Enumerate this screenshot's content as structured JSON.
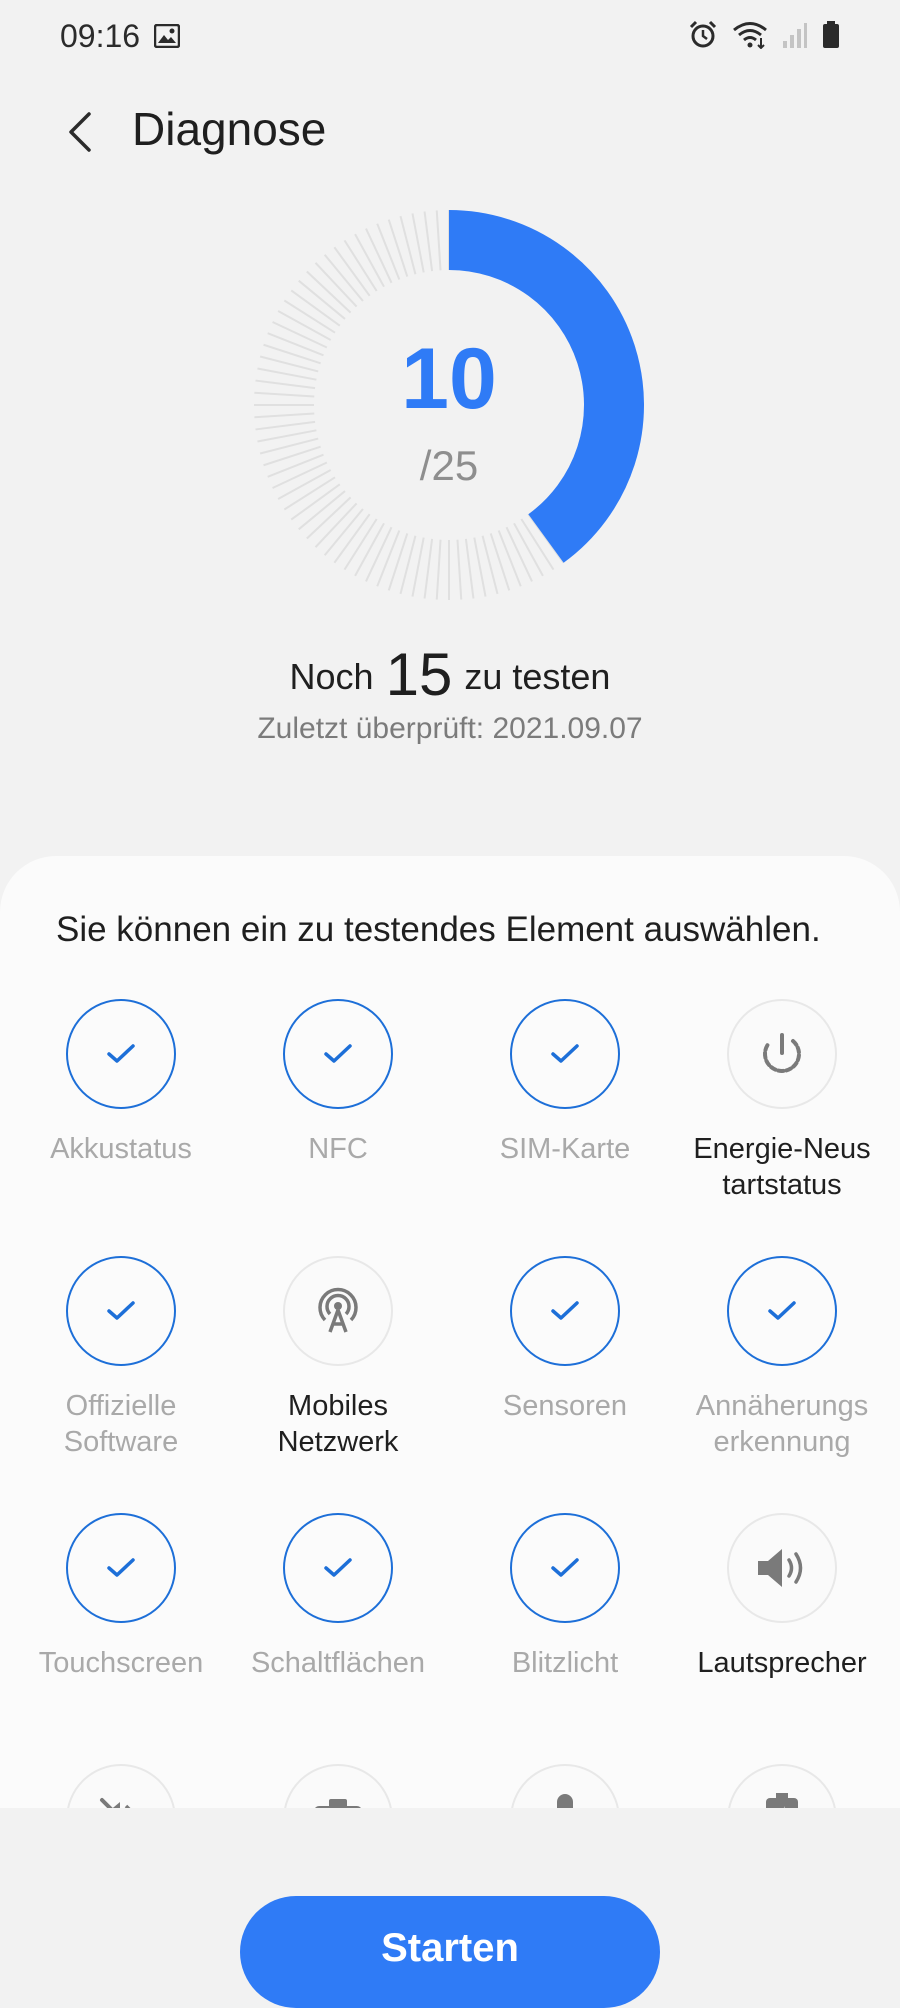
{
  "status": {
    "time": "09:16"
  },
  "header": {
    "title": "Diagnose"
  },
  "gauge": {
    "tested": "10",
    "total": "/25",
    "progress_fraction": 0.4,
    "accent": "#2f7bf6"
  },
  "summary": {
    "prefix": "Noch",
    "count": "15",
    "suffix": "zu testen",
    "last_checked": "Zuletzt überprüft: 2021.09.07"
  },
  "sheet": {
    "instructions": "Sie können ein zu testendes Element auswählen."
  },
  "items": [
    {
      "label": "Akkustatus",
      "status": "done",
      "icon": "check-icon"
    },
    {
      "label": "NFC",
      "status": "done",
      "icon": "check-icon"
    },
    {
      "label": "SIM-Karte",
      "status": "done",
      "icon": "check-icon"
    },
    {
      "label": "Energie-Neus tartstatus",
      "status": "pending",
      "icon": "power-restart-icon"
    },
    {
      "label": "Offizielle Software",
      "status": "done",
      "icon": "check-icon"
    },
    {
      "label": "Mobiles Netzwerk",
      "status": "pending",
      "icon": "antenna-icon"
    },
    {
      "label": "Sensoren",
      "status": "done",
      "icon": "check-icon"
    },
    {
      "label": "Annäherungs erkennung",
      "status": "done",
      "icon": "check-icon"
    },
    {
      "label": "Touchscreen",
      "status": "done",
      "icon": "check-icon"
    },
    {
      "label": "Schaltflächen",
      "status": "done",
      "icon": "check-icon"
    },
    {
      "label": "Blitzlicht",
      "status": "done",
      "icon": "check-icon"
    },
    {
      "label": "Lautsprecher",
      "status": "pending",
      "icon": "speaker-icon"
    },
    {
      "label": "",
      "status": "pending",
      "icon": "vibration-mute-icon"
    },
    {
      "label": "",
      "status": "pending",
      "icon": "camera-icon"
    },
    {
      "label": "",
      "status": "pending",
      "icon": "microphone-icon"
    },
    {
      "label": "",
      "status": "pending",
      "icon": "charging-icon"
    }
  ],
  "footer": {
    "start_label": "Starten"
  }
}
